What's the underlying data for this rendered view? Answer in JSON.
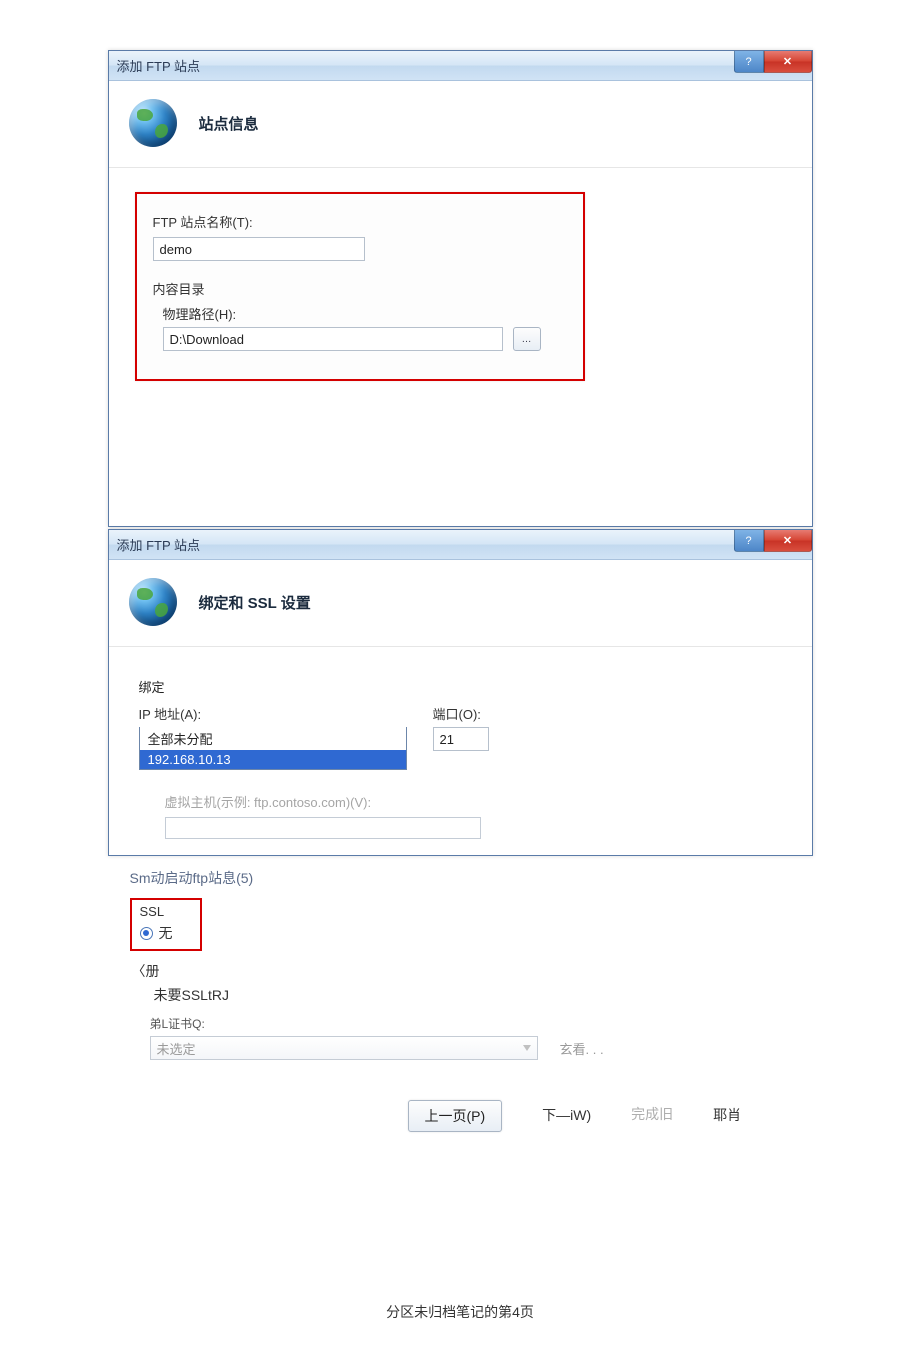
{
  "dialog1": {
    "title": "添加 FTP 站点",
    "header": "站点信息",
    "siteNameLabel": "FTP 站点名称(T):",
    "siteNameValue": "demo",
    "contentDir": "内容目录",
    "physPathLabel": "物理路径(H):",
    "physPathValue": "D:\\Download",
    "browse": "…"
  },
  "dialog2": {
    "title": "添加 FTP 站点",
    "header": "绑定和 SSL 设置",
    "bindingTitle": "绑定",
    "ipLabel": "IP 地址(A):",
    "ipValue": "全部未分配",
    "dropdown": {
      "opt1": "全部未分配",
      "opt2": "192.168.10.13"
    },
    "portLabel": "端口(O):",
    "portValue": "21",
    "vhostLabel": "虚拟主机(示例: ftp.contoso.com)(V):"
  },
  "frag": {
    "autostart": "Sm动启动ftp站息(5)",
    "sslTitle": "SSL",
    "sslNone": "无",
    "book": "〈册",
    "requireSSL": "未要SSLtRJ",
    "certLabel": "弟L证书Q:",
    "certValue": "未选定",
    "view": "玄看. . ."
  },
  "nav": {
    "prev": "上一页(P)",
    "next": "下—iW)",
    "finish": "完成旧",
    "cancel": "耶肖"
  },
  "footer": "分区未归档笔记的第4页"
}
